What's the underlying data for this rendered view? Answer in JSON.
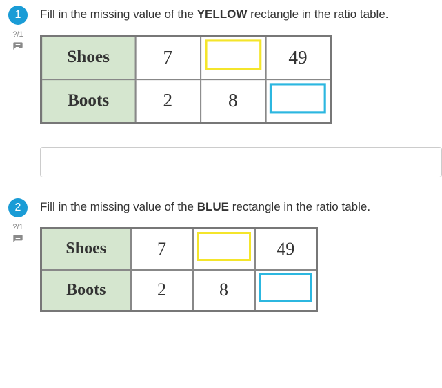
{
  "q1": {
    "number": "1",
    "points": "?/1",
    "prompt_pre": "Fill in the missing value of the ",
    "prompt_bold": "YELLOW",
    "prompt_post": " rectangle in the ratio table.",
    "table": {
      "row1_label": "Shoes",
      "row2_label": "Boots",
      "r1c1": "7",
      "r1c2": "",
      "r1c3": "49",
      "r2c1": "2",
      "r2c2": "8",
      "r2c3": ""
    },
    "answer": ""
  },
  "q2": {
    "number": "2",
    "points": "?/1",
    "prompt_pre": "Fill in the missing value of the ",
    "prompt_bold": "BLUE",
    "prompt_post": " rectangle in the ratio table.",
    "table": {
      "row1_label": "Shoes",
      "row2_label": "Boots",
      "r1c1": "7",
      "r1c2": "",
      "r1c3": "49",
      "r2c1": "2",
      "r2c2": "8",
      "r2c3": ""
    }
  }
}
